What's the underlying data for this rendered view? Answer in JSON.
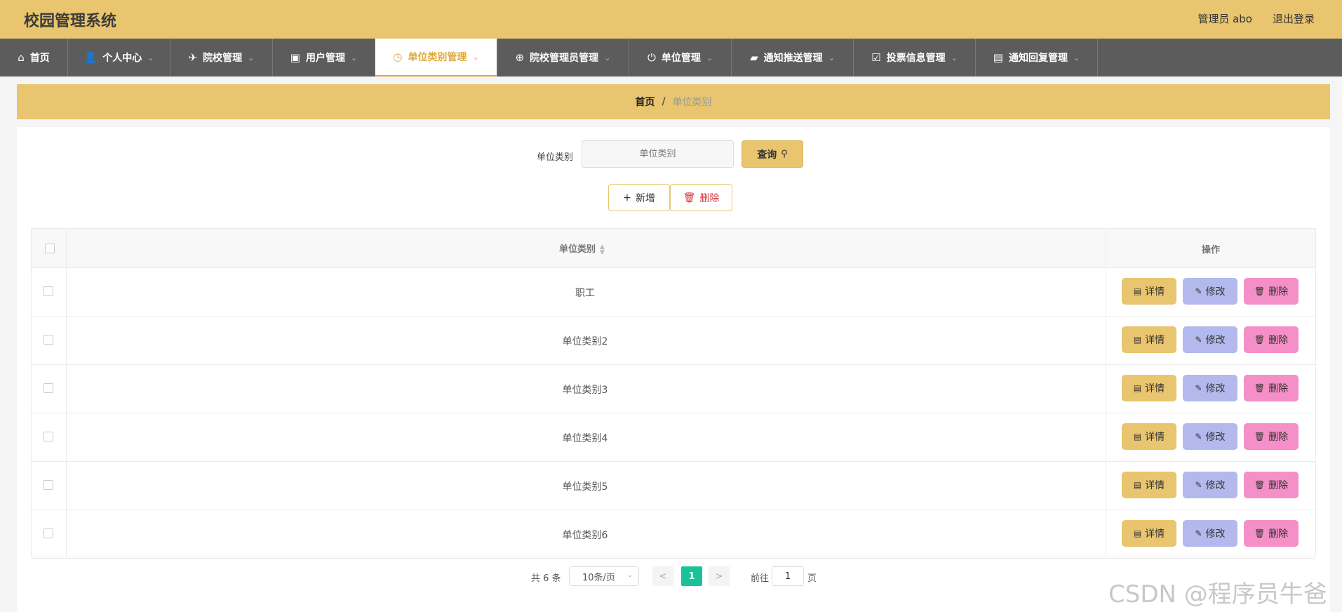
{
  "app": {
    "title": "校园管理系统",
    "admin": "管理员 abo",
    "logout": "退出登录"
  },
  "nav": [
    {
      "label": "首页",
      "icon": "home-icon",
      "glyph": "⌂",
      "caret": false,
      "active": false
    },
    {
      "label": "个人中心",
      "icon": "user-icon",
      "glyph": "👤",
      "caret": true,
      "active": false
    },
    {
      "label": "院校管理",
      "icon": "paper-plane-icon",
      "glyph": "✈",
      "caret": true,
      "active": false
    },
    {
      "label": "用户管理",
      "icon": "clipboard-x-icon",
      "glyph": "▣",
      "caret": true,
      "active": false
    },
    {
      "label": "单位类别管理",
      "icon": "clock-icon",
      "glyph": "◷",
      "caret": true,
      "active": true
    },
    {
      "label": "院校管理员管理",
      "icon": "crosshair-icon",
      "glyph": "⊕",
      "caret": true,
      "active": false
    },
    {
      "label": "单位管理",
      "icon": "power-icon",
      "glyph": "⏻",
      "caret": true,
      "active": false
    },
    {
      "label": "通知推送管理",
      "icon": "briefcase-icon",
      "glyph": "▰",
      "caret": true,
      "active": false
    },
    {
      "label": "投票信息管理",
      "icon": "clipboard-check-icon",
      "glyph": "☑",
      "caret": true,
      "active": false
    },
    {
      "label": "通知回复管理",
      "icon": "document-icon",
      "glyph": "▤",
      "caret": true,
      "active": false
    }
  ],
  "breadcrumb": {
    "home": "首页",
    "separator": "/",
    "current": "单位类别"
  },
  "search": {
    "label": "单位类别",
    "placeholder": "单位类别",
    "button": "查询"
  },
  "actions": {
    "add": "新增",
    "delete": "删除"
  },
  "table": {
    "columns": [
      "单位类别",
      "操作"
    ],
    "rows": [
      {
        "category": "职工"
      },
      {
        "category": "单位类别2"
      },
      {
        "category": "单位类别3"
      },
      {
        "category": "单位类别4"
      },
      {
        "category": "单位类别5"
      },
      {
        "category": "单位类别6"
      }
    ],
    "row_actions": {
      "detail": "详情",
      "edit": "修改",
      "delete": "删除"
    }
  },
  "pagination": {
    "total": "共 6 条",
    "page_size": "10条/页",
    "current_page": "1",
    "goto_label": "前往",
    "goto_value": "1",
    "goto_unit": "页"
  },
  "watermark": "CSDN @程序员牛爸",
  "colors": {
    "header": "#e8c56e",
    "nav": "#5c5c5c",
    "active_text": "#e0a93a",
    "detail_btn": "#e8c56e",
    "edit_btn": "#b3b9ec",
    "delete_btn": "#f48fc7",
    "page_active": "#19c39a"
  }
}
